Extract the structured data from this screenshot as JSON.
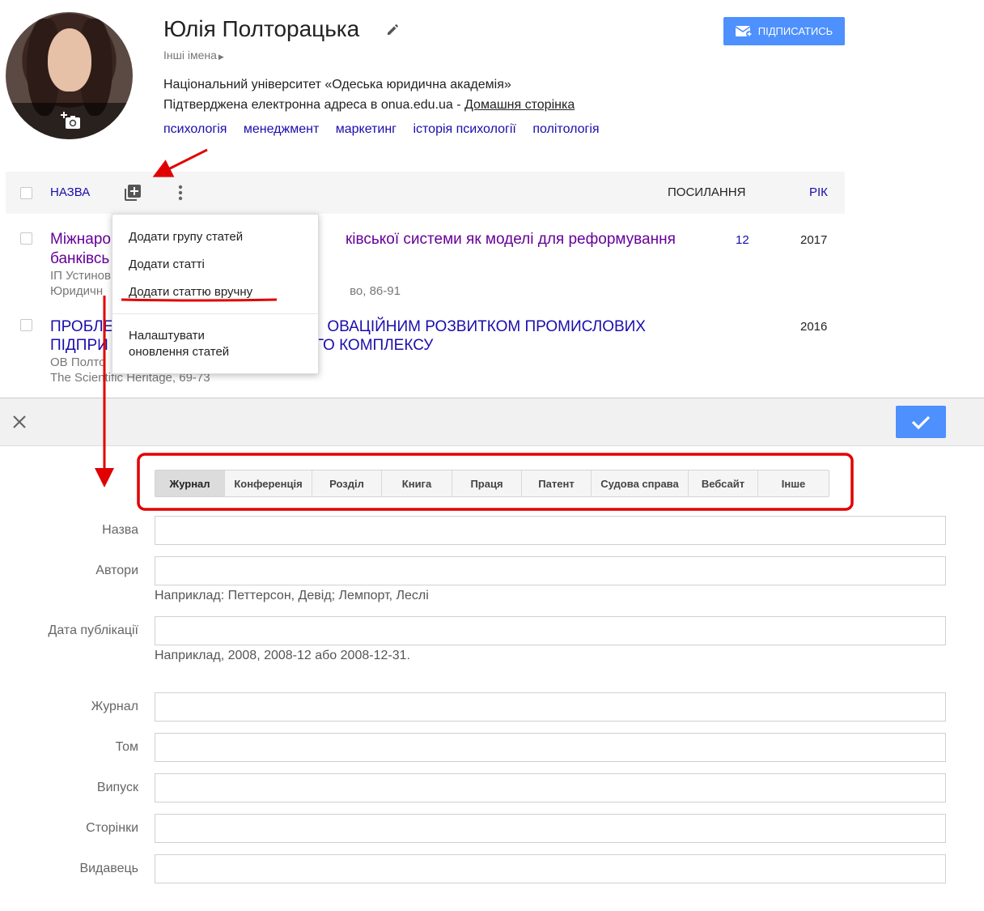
{
  "profile": {
    "name": "Юлія Полторацька",
    "other_names": "Інші імена",
    "affiliation": "Національний університет «Одеська юридична академія»",
    "email_text": "Підтверджена електронна адреса в onua.edu.ua -",
    "homepage": "Домашня сторінка",
    "tags": [
      "психологія",
      "менеджмент",
      "маркетинг",
      "історія психології",
      "політологія"
    ],
    "follow_label": "ПІДПИСАТИСЬ"
  },
  "table": {
    "col_title": "НАЗВА",
    "col_citations": "ПОСИЛАННЯ",
    "col_year": "РІК",
    "rows": [
      {
        "title_line1": "Міжнаро                                              ківської системи як моделі для реформування",
        "title_a": "Міжнаро",
        "title_b": "ківської системи як моделі для реформування",
        "title_line2": "банківсь",
        "authors": "ІП Устинов",
        "source_a": "Юридичн",
        "source_b": "во, 86-91",
        "citations": "12",
        "year": "2017"
      },
      {
        "title_a": "ПРОБЛЕ",
        "title_b": "ОВАЦІЙНИМ РОЗВИТКОМ ПРОМИСЛОВИХ",
        "title2_a": "ПІДПРИ",
        "title2_b": "ГО КОМПЛЕКСУ",
        "authors": "ОВ Полто",
        "source": "The Scientific Heritage, 69-73",
        "citations": "",
        "year": "2016"
      }
    ]
  },
  "menu": {
    "items": [
      "Додати групу статей",
      "Додати статті",
      "Додати статтю вручну"
    ],
    "settings_line1": "Налаштувати",
    "settings_line2": "оновлення статей"
  },
  "form": {
    "types": [
      "Журнал",
      "Конференція",
      "Розділ",
      "Книга",
      "Праця",
      "Патент",
      "Судова справа",
      "Вебсайт",
      "Інше"
    ],
    "active_type": "Журнал",
    "fields": {
      "title": "Назва",
      "authors": "Автори",
      "authors_hint": "Наприклад: Петтерсон, Девід; Лемпорт, Леслі",
      "date": "Дата публікації",
      "date_hint": "Наприклад, 2008, 2008-12 або 2008-12-31.",
      "journal": "Журнал",
      "volume": "Том",
      "issue": "Випуск",
      "pages": "Сторінки",
      "publisher": "Видавець"
    }
  },
  "colors": {
    "link": "#1a0dab",
    "visited": "#660099",
    "primary_button": "#4d90fe",
    "annotation": "#e00000"
  }
}
